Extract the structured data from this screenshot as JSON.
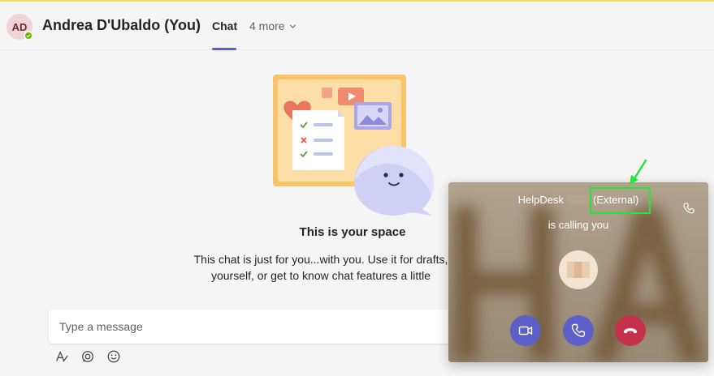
{
  "header": {
    "avatar_initials": "AD",
    "title": "Andrea D'Ubaldo (You)",
    "tabs": {
      "active": "Chat",
      "more": "4 more"
    }
  },
  "empty_state": {
    "title": "This is your space",
    "description_line1": "This chat is just for you...with you. Use it for drafts,",
    "description_line2": "yourself, or get to know chat features a little"
  },
  "compose": {
    "placeholder": "Type a message",
    "tools": [
      "format-icon",
      "loop-icon",
      "emoji-icon"
    ]
  },
  "incoming_call": {
    "caller_name": "HelpDesk",
    "caller_tag": "(External)",
    "status": "is calling you",
    "buttons": [
      "video-call",
      "audio-call",
      "decline-call"
    ]
  },
  "colors": {
    "accent": "#5b5fc7",
    "decline": "#c4314b",
    "presence": "#6bb700",
    "highlight": "#27e33a"
  }
}
